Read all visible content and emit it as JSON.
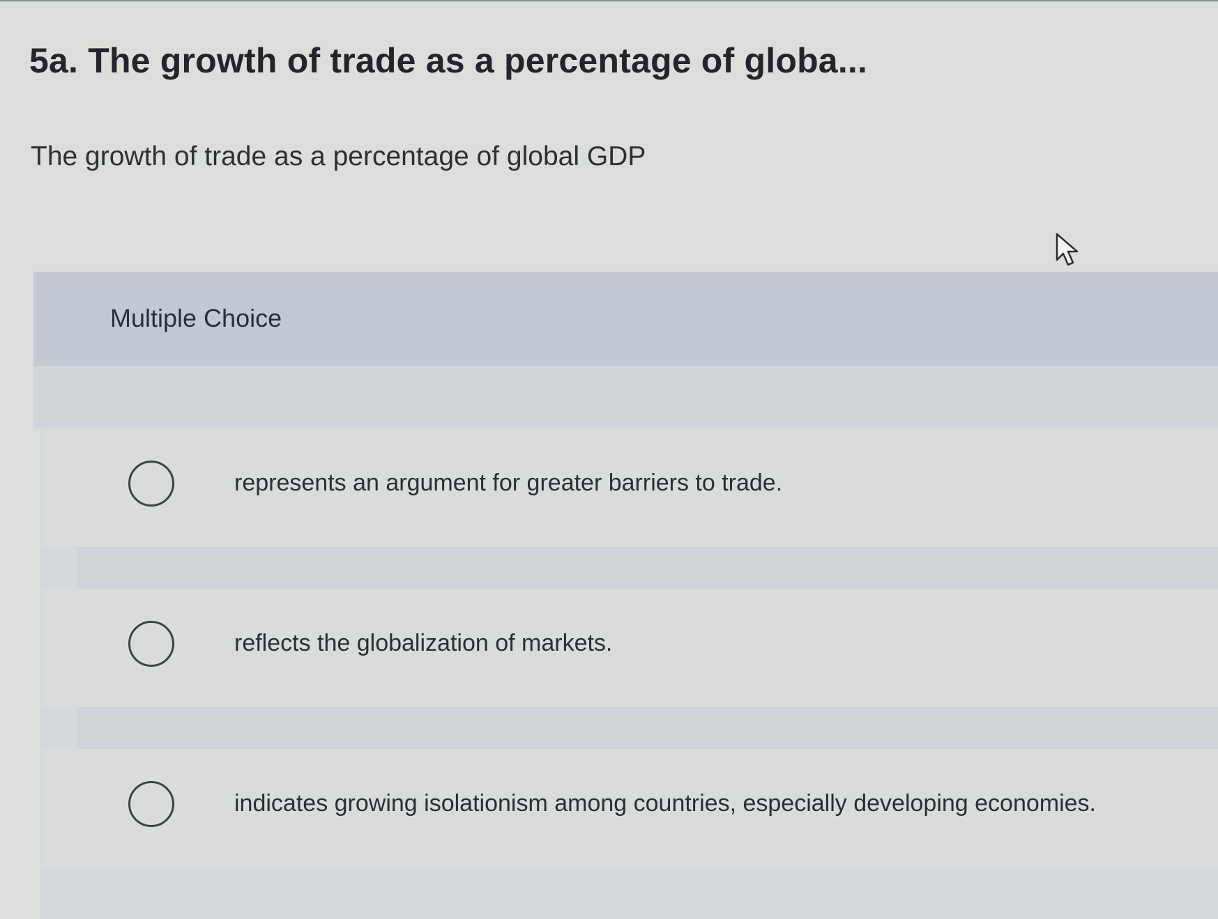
{
  "question": {
    "heading": "5a. The growth of trade as a percentage of globa...",
    "text": "The growth of trade as a percentage of global GDP"
  },
  "multiple_choice": {
    "label": "Multiple Choice",
    "options": [
      {
        "text": "represents an argument for greater barriers to trade.",
        "selected": false
      },
      {
        "text": "reflects the globalization of markets.",
        "selected": false
      },
      {
        "text": "indicates growing isolationism among countries, especially developing economies.",
        "selected": false
      }
    ]
  },
  "icons": {
    "radio": "radio-button-icon",
    "cursor": "mouse-pointer-icon"
  },
  "colors": {
    "page_background": "#dcdedb",
    "header_band": "#c1c9d4",
    "text": "#2b2d31",
    "radio_border": "#3f4246"
  }
}
